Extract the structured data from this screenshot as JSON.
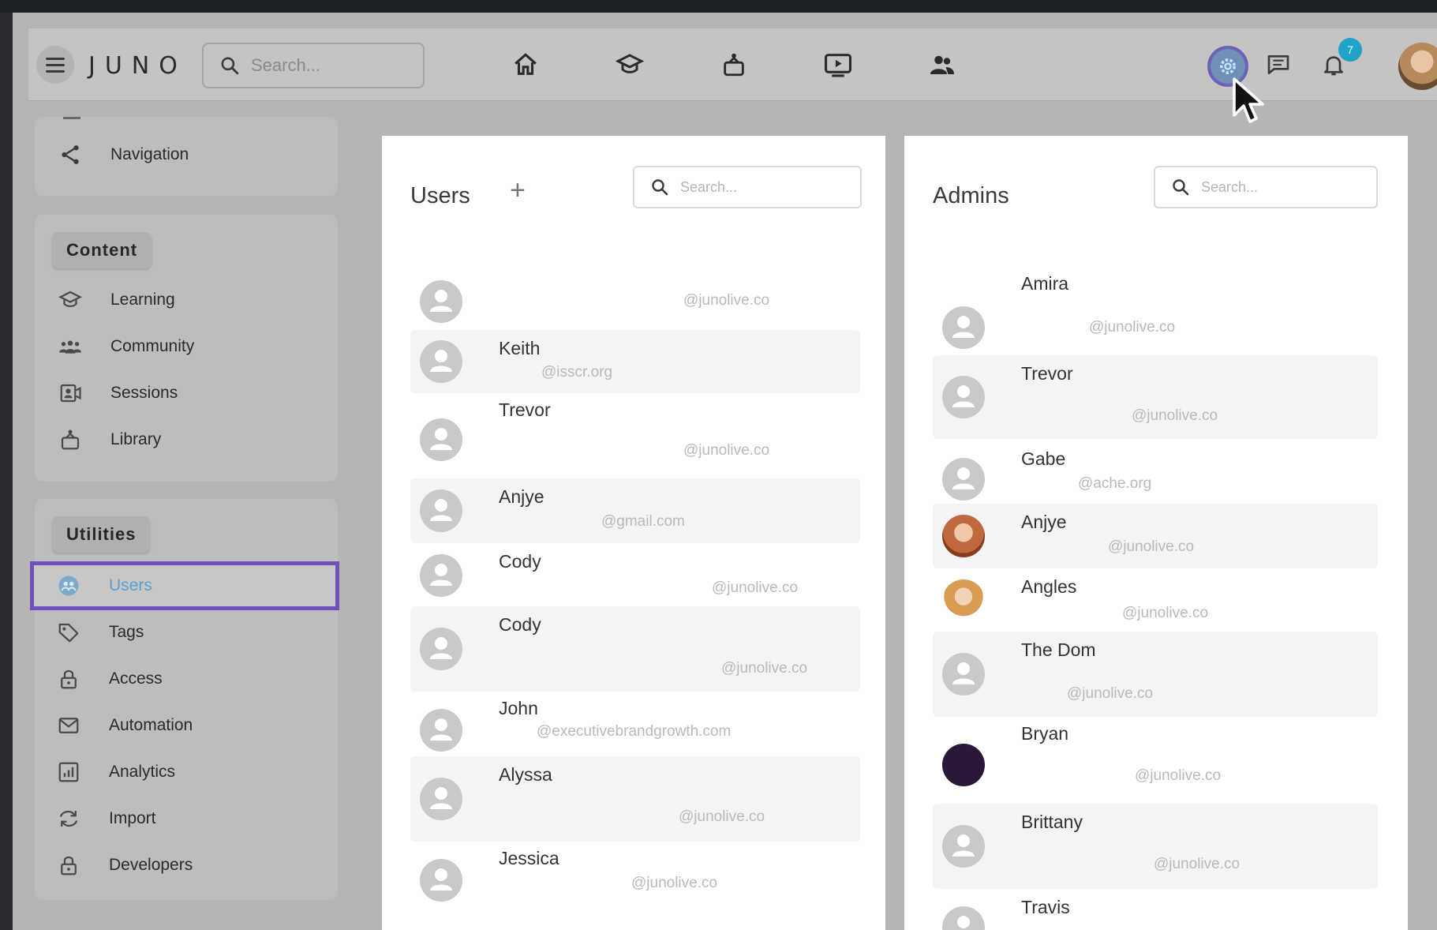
{
  "header": {
    "logo": "JUNO",
    "search_placeholder": "Search...",
    "nav_icons": [
      "home-icon",
      "graduation-cap-icon",
      "library-icon",
      "video-icon",
      "community-icon"
    ],
    "notification_count": "7",
    "colors": {
      "admin_highlight": "#7151b8",
      "badge": "#1fa3c9"
    }
  },
  "sidebar": {
    "top_item": "Navigation",
    "content_section": {
      "title": "Content",
      "items": [
        "Learning",
        "Community",
        "Sessions",
        "Library"
      ]
    },
    "utilities_section": {
      "title": "Utilities",
      "items": [
        "Users",
        "Tags",
        "Access",
        "Automation",
        "Analytics",
        "Import",
        "Developers"
      ],
      "selected": "Users"
    }
  },
  "users_panel": {
    "title": "Users",
    "add_label": "+",
    "search_placeholder": "Search...",
    "rows": [
      {
        "name": "",
        "email": "@junolive.co"
      },
      {
        "name": "Keith",
        "email": "@isscr.org"
      },
      {
        "name": "Trevor",
        "email": "@junolive.co"
      },
      {
        "name": "Anjye",
        "email": "@gmail.com"
      },
      {
        "name": "Cody",
        "email": "@junolive.co"
      },
      {
        "name": "Cody",
        "email": "@junolive.co"
      },
      {
        "name": "John",
        "email": "@executivebrandgrowth.com"
      },
      {
        "name": "Alyssa",
        "email": "@junolive.co"
      },
      {
        "name": "Jessica",
        "email": "@junolive.co"
      }
    ]
  },
  "admins_panel": {
    "title": "Admins",
    "search_placeholder": "Search...",
    "rows": [
      {
        "name": "Amira",
        "email": "@junolive.co"
      },
      {
        "name": "Trevor",
        "email": "@junolive.co"
      },
      {
        "name": "Gabe",
        "email": "@ache.org"
      },
      {
        "name": "Anjye",
        "email": "@junolive.co"
      },
      {
        "name": "Angles",
        "email": "@junolive.co"
      },
      {
        "name": "The Dom",
        "email": "@junolive.co"
      },
      {
        "name": "Bryan",
        "email": "@junolive.co"
      },
      {
        "name": "Brittany",
        "email": "@junolive.co"
      },
      {
        "name": "Travis",
        "email": ""
      }
    ]
  }
}
